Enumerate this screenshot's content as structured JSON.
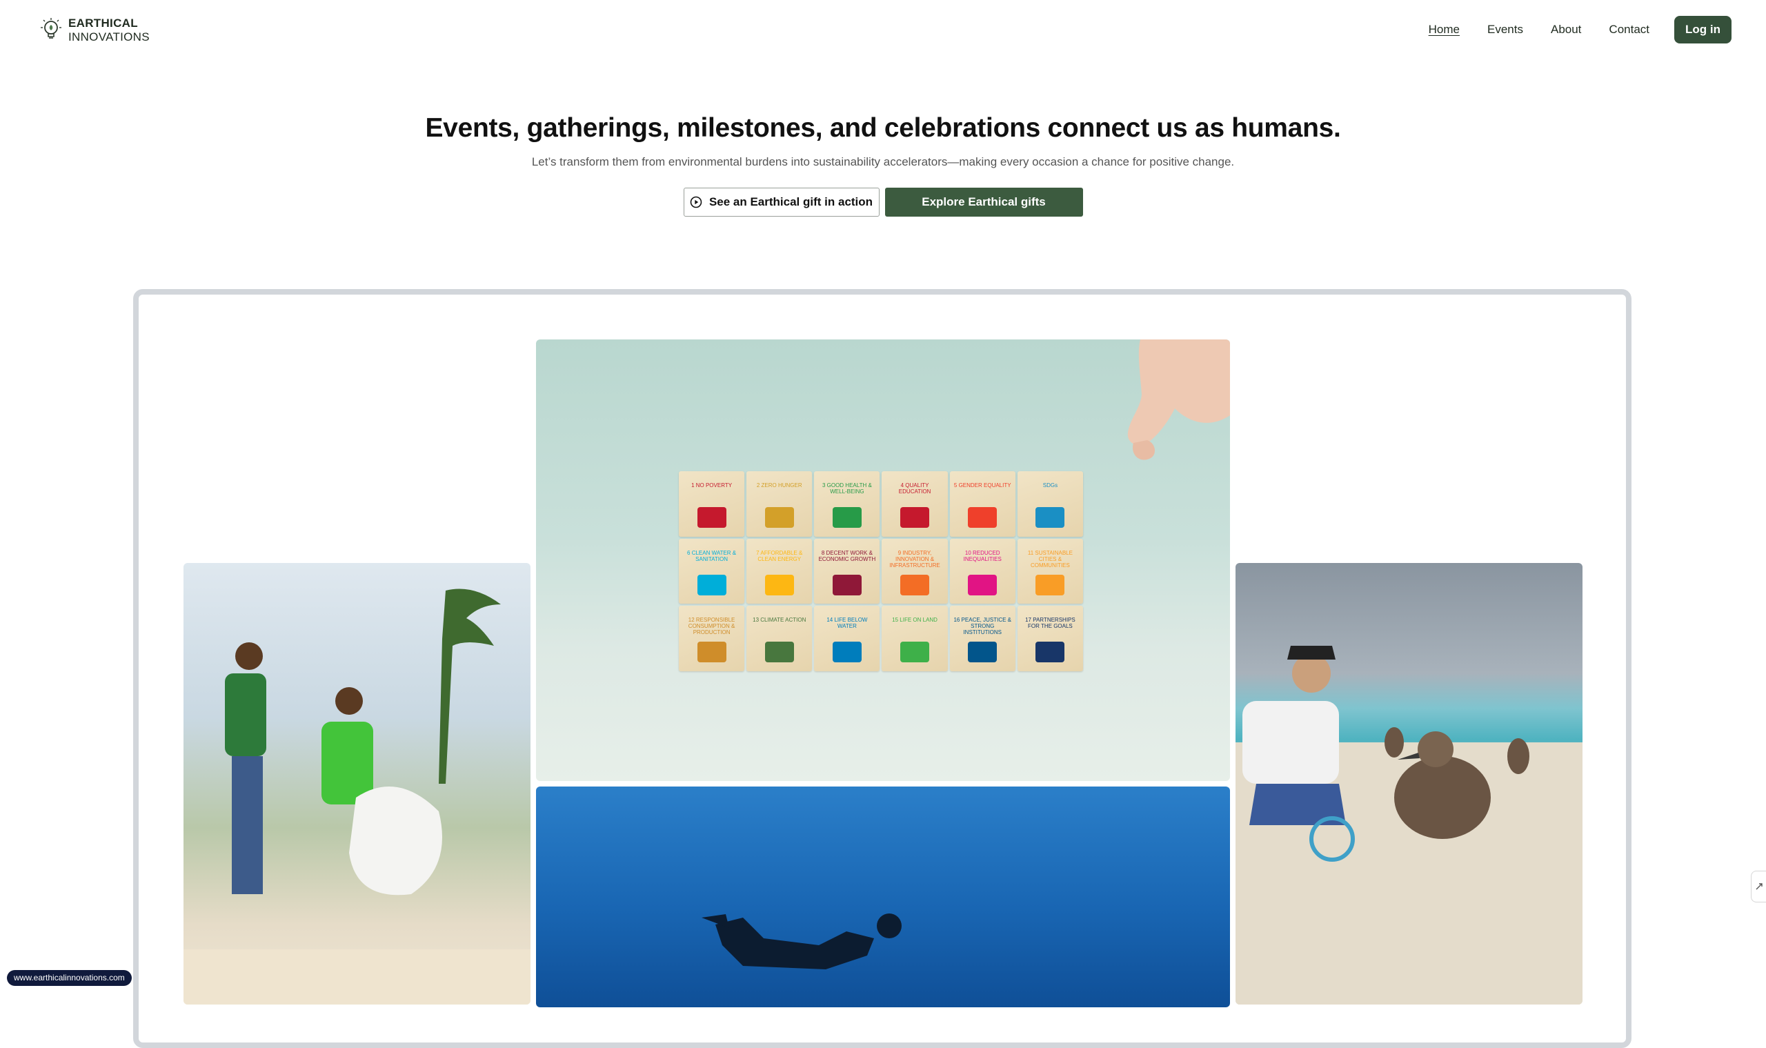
{
  "brand": {
    "name_line1": "EARTHICAL",
    "name_line2": "INNOVATIONS",
    "logo_icon": "lightbulb-leaf-icon"
  },
  "nav": {
    "items": [
      {
        "label": "Home",
        "active": true
      },
      {
        "label": "Events",
        "active": false
      },
      {
        "label": "About",
        "active": false
      },
      {
        "label": "Contact",
        "active": false
      }
    ],
    "login_label": "Log in"
  },
  "hero": {
    "title": "Events, gatherings, milestones, and celebrations connect us as humans.",
    "subtitle": "Let’s transform them from environmental burdens into sustainability accelerators—making every occasion a chance for positive change.",
    "secondary_button": "See an Earthical gift in action",
    "primary_button": "Explore Earthical gifts"
  },
  "sdg_blocks": [
    {
      "label": "1 NO POVERTY",
      "color": "#c5192d"
    },
    {
      "label": "2 ZERO HUNGER",
      "color": "#d3a029"
    },
    {
      "label": "3 GOOD HEALTH & WELL-BEING",
      "color": "#279b48"
    },
    {
      "label": "4 QUALITY EDUCATION",
      "color": "#c5192d"
    },
    {
      "label": "5 GENDER EQUALITY",
      "color": "#ef402b"
    },
    {
      "label": "SDGs",
      "color": "#1a8fc4"
    },
    {
      "label": "6 CLEAN WATER & SANITATION",
      "color": "#00aed9"
    },
    {
      "label": "7 AFFORDABLE & CLEAN ENERGY",
      "color": "#fdb713"
    },
    {
      "label": "8 DECENT WORK & ECONOMIC GROWTH",
      "color": "#8f1838"
    },
    {
      "label": "9 INDUSTRY, INNOVATION & INFRASTRUCTURE",
      "color": "#f36d25"
    },
    {
      "label": "10 REDUCED INEQUALITIES",
      "color": "#e11484"
    },
    {
      "label": "11 SUSTAINABLE CITIES & COMMUNITIES",
      "color": "#f99d26"
    },
    {
      "label": "12 RESPONSIBLE CONSUMPTION & PRODUCTION",
      "color": "#cf8d2a"
    },
    {
      "label": "13 CLIMATE ACTION",
      "color": "#48773e"
    },
    {
      "label": "14 LIFE BELOW WATER",
      "color": "#007dbc"
    },
    {
      "label": "15 LIFE ON LAND",
      "color": "#3eb049"
    },
    {
      "label": "16 PEACE, JUSTICE & STRONG INSTITUTIONS",
      "color": "#02558b"
    },
    {
      "label": "17 PARTNERSHIPS FOR THE GOALS",
      "color": "#183668"
    }
  ],
  "footer": {
    "url": "www.earthicalinnovations.com"
  },
  "colors": {
    "brand_green": "#35503a",
    "button_green": "#3c5b3f",
    "frame_gray": "#d2d6db"
  }
}
